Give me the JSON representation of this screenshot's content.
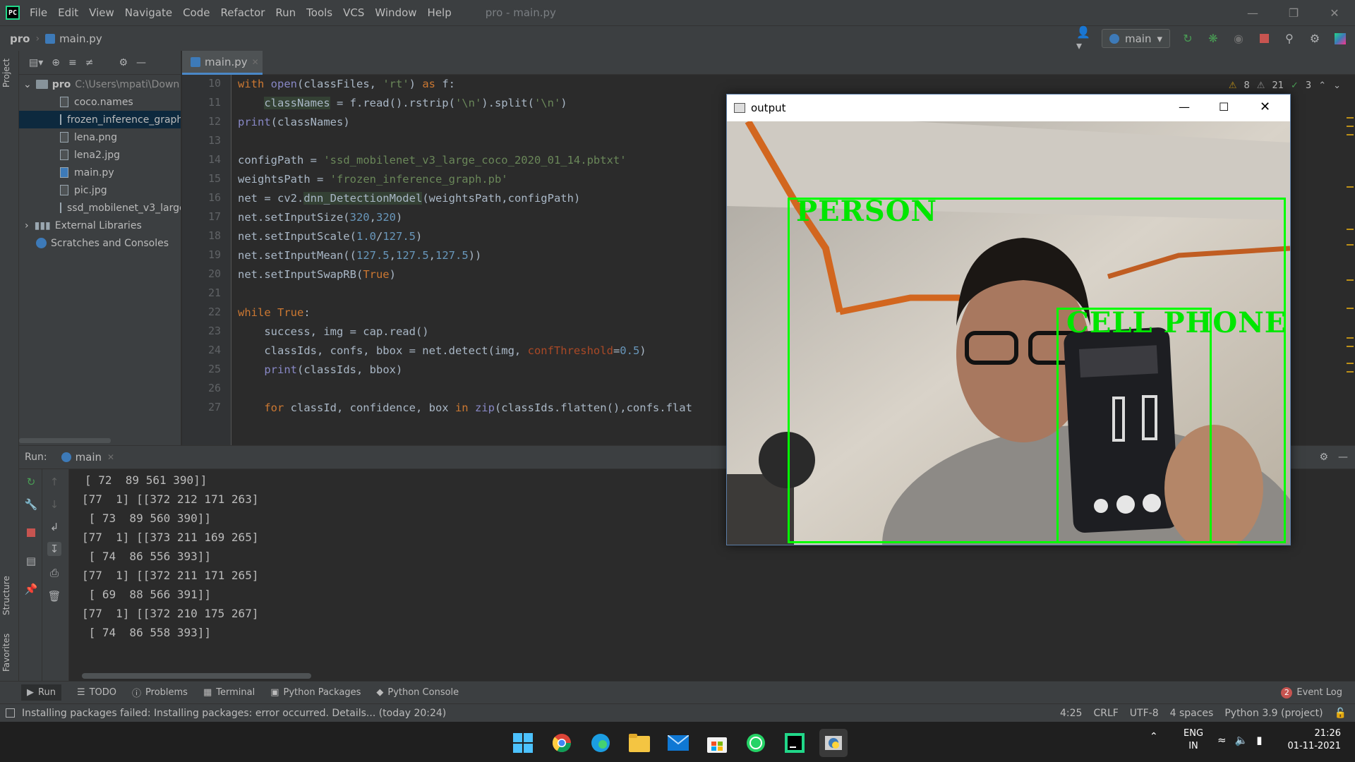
{
  "app": {
    "window_title": "pro - main.py",
    "logo_text": "PC"
  },
  "menu": [
    "File",
    "Edit",
    "View",
    "Navigate",
    "Code",
    "Refactor",
    "Run",
    "Tools",
    "VCS",
    "Window",
    "Help"
  ],
  "breadcrumb": {
    "project": "pro",
    "file": "main.py"
  },
  "run_config": {
    "label": "main"
  },
  "side_tabs": {
    "project": "Project",
    "structure": "Structure",
    "favorites": "Favorites"
  },
  "project_tree": {
    "root_name": "pro",
    "root_path": "C:\\Users\\mpati\\Down",
    "files": [
      "coco.names",
      "frozen_inference_graph",
      "lena.png",
      "lena2.jpg",
      "main.py",
      "pic.jpg",
      "ssd_mobilenet_v3_large"
    ],
    "selected": "frozen_inference_graph",
    "external_libraries": "External Libraries",
    "scratches": "Scratches and Consoles"
  },
  "editor": {
    "tab_label": "main.py",
    "inspection": {
      "warnings": "8",
      "weak_warnings": "21",
      "ok": "3"
    },
    "line_numbers": [
      "10",
      "11",
      "12",
      "13",
      "14",
      "15",
      "16",
      "17",
      "18",
      "19",
      "20",
      "21",
      "22",
      "23",
      "24",
      "25",
      "26",
      "27"
    ]
  },
  "output_window": {
    "title": "output",
    "labels": {
      "person": "PERSON",
      "phone": "CELL PHONE"
    }
  },
  "run_panel": {
    "label": "Run:",
    "tab": "main",
    "console_lines": [
      "[ 72  89 561 390]]",
      "[77  1] [[372 212 171 263]",
      " [ 73  89 560 390]]",
      "[77  1] [[373 211 169 265]",
      " [ 74  86 556 393]]",
      "[77  1] [[372 211 171 265]",
      " [ 69  88 566 391]]",
      "[77  1] [[372 210 175 267]",
      " [ 74  86 558 393]]"
    ]
  },
  "bottom_tabs": [
    "Run",
    "TODO",
    "Problems",
    "Terminal",
    "Python Packages",
    "Python Console"
  ],
  "event_log": {
    "count": "2",
    "label": "Event Log"
  },
  "status": {
    "message": "Installing packages failed: Installing packages: error occurred. Details... (today 20:24)",
    "position": "4:25",
    "line_sep": "CRLF",
    "encoding": "UTF-8",
    "indent": "4 spaces",
    "interpreter": "Python 3.9 (project)"
  },
  "taskbar": {
    "lang": "ENG",
    "region": "IN",
    "time": "21:26",
    "date": "01-11-2021"
  },
  "colors": {
    "accent": "#4a88c7",
    "detection_box": "#00ff00",
    "keyword": "#cc7832",
    "string": "#6a8759",
    "number": "#6897bb"
  }
}
